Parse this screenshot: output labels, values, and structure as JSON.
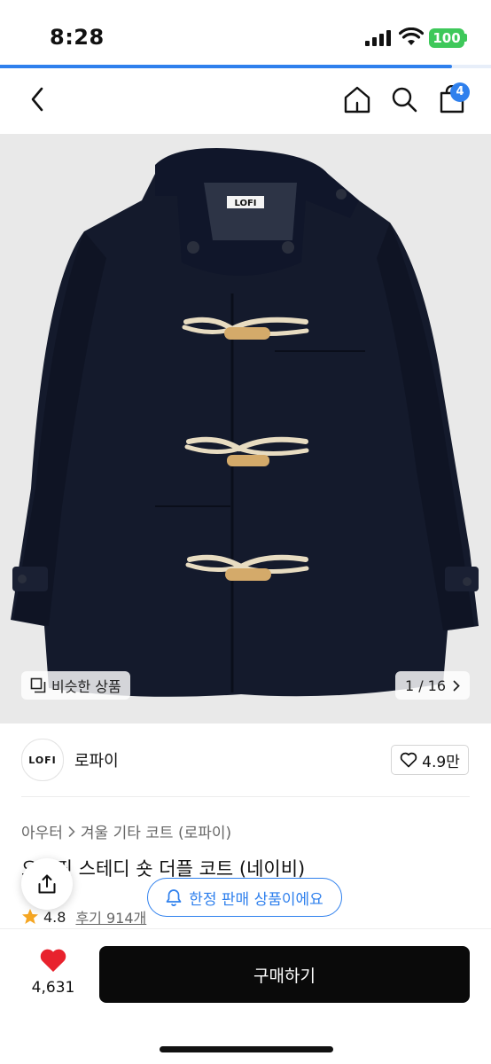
{
  "status_bar": {
    "time": "8:28",
    "battery": "100"
  },
  "page_progress": 0.92,
  "nav": {
    "cart_count": "4"
  },
  "hero": {
    "coat_label": "LOFI",
    "similar_label": "비슷한 상품",
    "pager": "1 / 16"
  },
  "brand": {
    "logo_text": "LOFI",
    "name": "로파이",
    "likes": "4.9만"
  },
  "product": {
    "category_root": "아우터",
    "category_path": "겨울 기타 코트 (로파이)",
    "title": "오버핏 스테디 숏 더플 코트 (네이비)",
    "rating": "4.8",
    "reviews": "후기 914개"
  },
  "limited_notice": "한정 판매 상품이에요",
  "bottom_bar": {
    "wish_count": "4,631",
    "buy_label": "구매하기"
  },
  "colors": {
    "accent": "#2f80ed",
    "battery": "#3ec85a",
    "coat": "#141a2c",
    "toggle": "#e8dcc1"
  }
}
